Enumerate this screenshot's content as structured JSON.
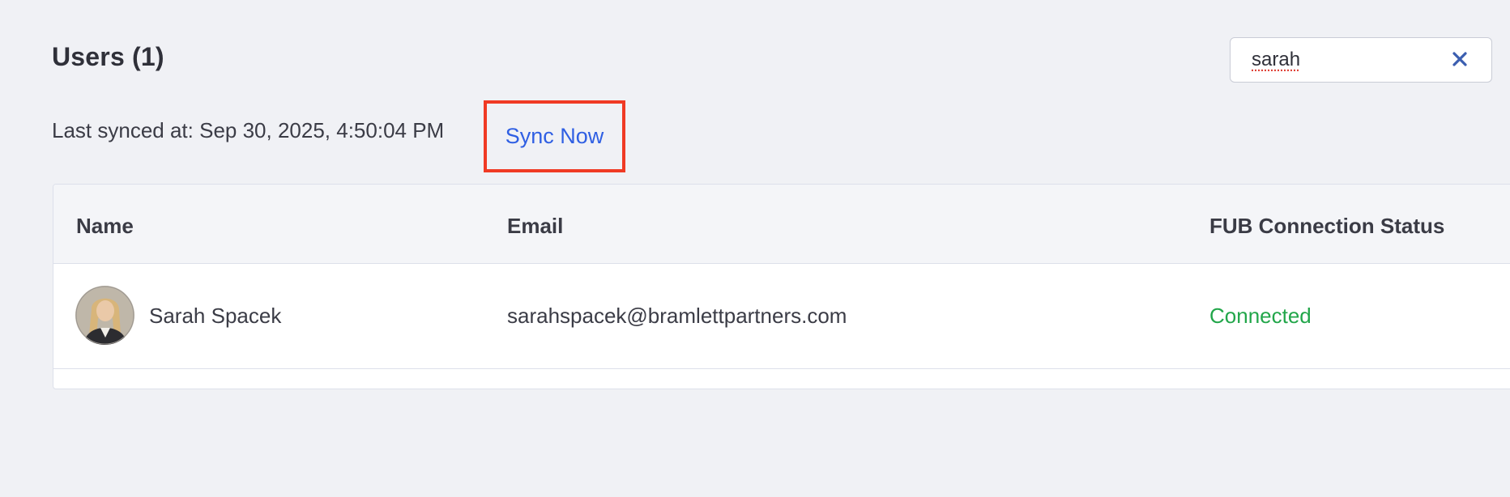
{
  "header": {
    "title": "Users (1)"
  },
  "search": {
    "value": "sarah",
    "clear_icon": "close-icon"
  },
  "sync": {
    "last_synced": "Last synced at: Sep 30, 2025, 4:50:04 PM",
    "sync_now_label": "Sync Now",
    "highlight_color": "#f03a24",
    "link_color": "#2f5fe3"
  },
  "table": {
    "columns": [
      "Name",
      "Email",
      "FUB Connection Status"
    ],
    "rows": [
      {
        "avatar_icon": "user-avatar",
        "name": "Sarah Spacek",
        "email": "sarahspacek@bramlettpartners.com",
        "status": "Connected",
        "status_color": "#22a64a"
      }
    ]
  }
}
